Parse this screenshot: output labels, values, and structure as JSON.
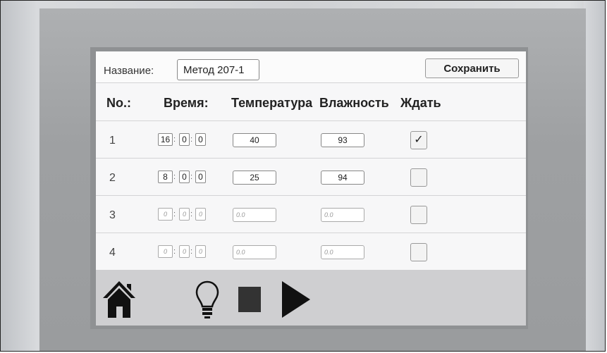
{
  "header": {
    "name_label": "Название:",
    "name_value": "Метод 207-1",
    "save_label": "Сохранить"
  },
  "columns": {
    "no": "No.:",
    "time": "Время:",
    "temperature": "Температура",
    "humidity": "Влажность",
    "wait": "Ждать"
  },
  "rows": [
    {
      "no": "1",
      "hours": "16",
      "minutes": "0",
      "seconds": "0",
      "temperature": "40",
      "humidity": "93",
      "wait": true
    },
    {
      "no": "2",
      "hours": "8",
      "minutes": "0",
      "seconds": "0",
      "temperature": "25",
      "humidity": "94",
      "wait": false
    },
    {
      "no": "3",
      "hours": "0",
      "minutes": "0",
      "seconds": "0",
      "temperature": "0.0",
      "humidity": "0.0",
      "wait": false
    },
    {
      "no": "4",
      "hours": "0",
      "minutes": "0",
      "seconds": "0",
      "temperature": "0.0",
      "humidity": "0.0",
      "wait": false
    }
  ],
  "time_separator": ":",
  "check_mark": "✓",
  "toolbar": {
    "icons": [
      "home-icon",
      "lightbulb-icon",
      "stop-icon",
      "play-icon"
    ]
  },
  "colors": {
    "screen_bg": "#f7f7f8",
    "toolbar_bg": "#cfcfd1",
    "bezel": "#9ea0a2",
    "icon": "#111111"
  }
}
